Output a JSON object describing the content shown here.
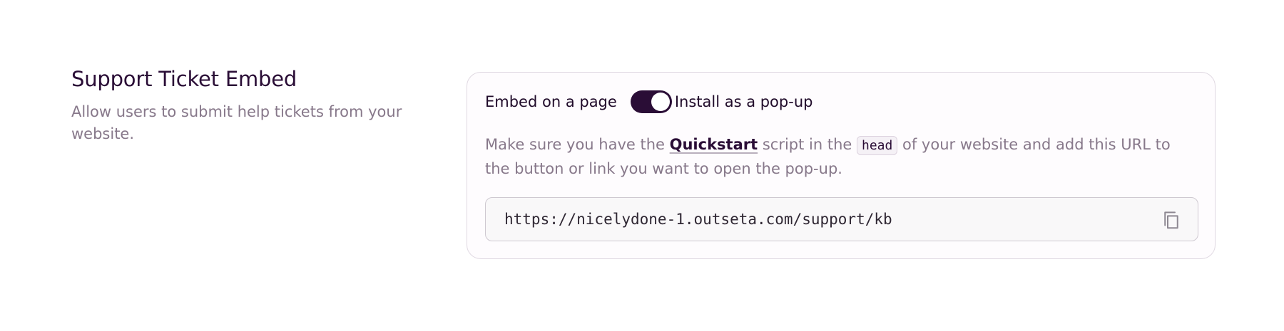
{
  "section": {
    "title": "Support Ticket Embed",
    "description": "Allow users to submit help tickets from your website."
  },
  "embed_toggle": {
    "left_label": "Embed on a page",
    "right_label": "Install as a pop-up",
    "selected": "Install as a pop-up",
    "on": true
  },
  "instructions": {
    "part1": "Make sure you have the ",
    "link_text": "Quickstart",
    "part2": " script in the ",
    "code": "head",
    "part3": " of your website and add this URL to the button or link you want to open the pop-up."
  },
  "url_field": {
    "value": "https://nicelydone-1.outseta.com/support/kb",
    "copy_icon": "copy-icon"
  },
  "colors": {
    "brand": "#2a0d36",
    "muted_text": "#87788a",
    "card_border": "#e0d9e2"
  }
}
